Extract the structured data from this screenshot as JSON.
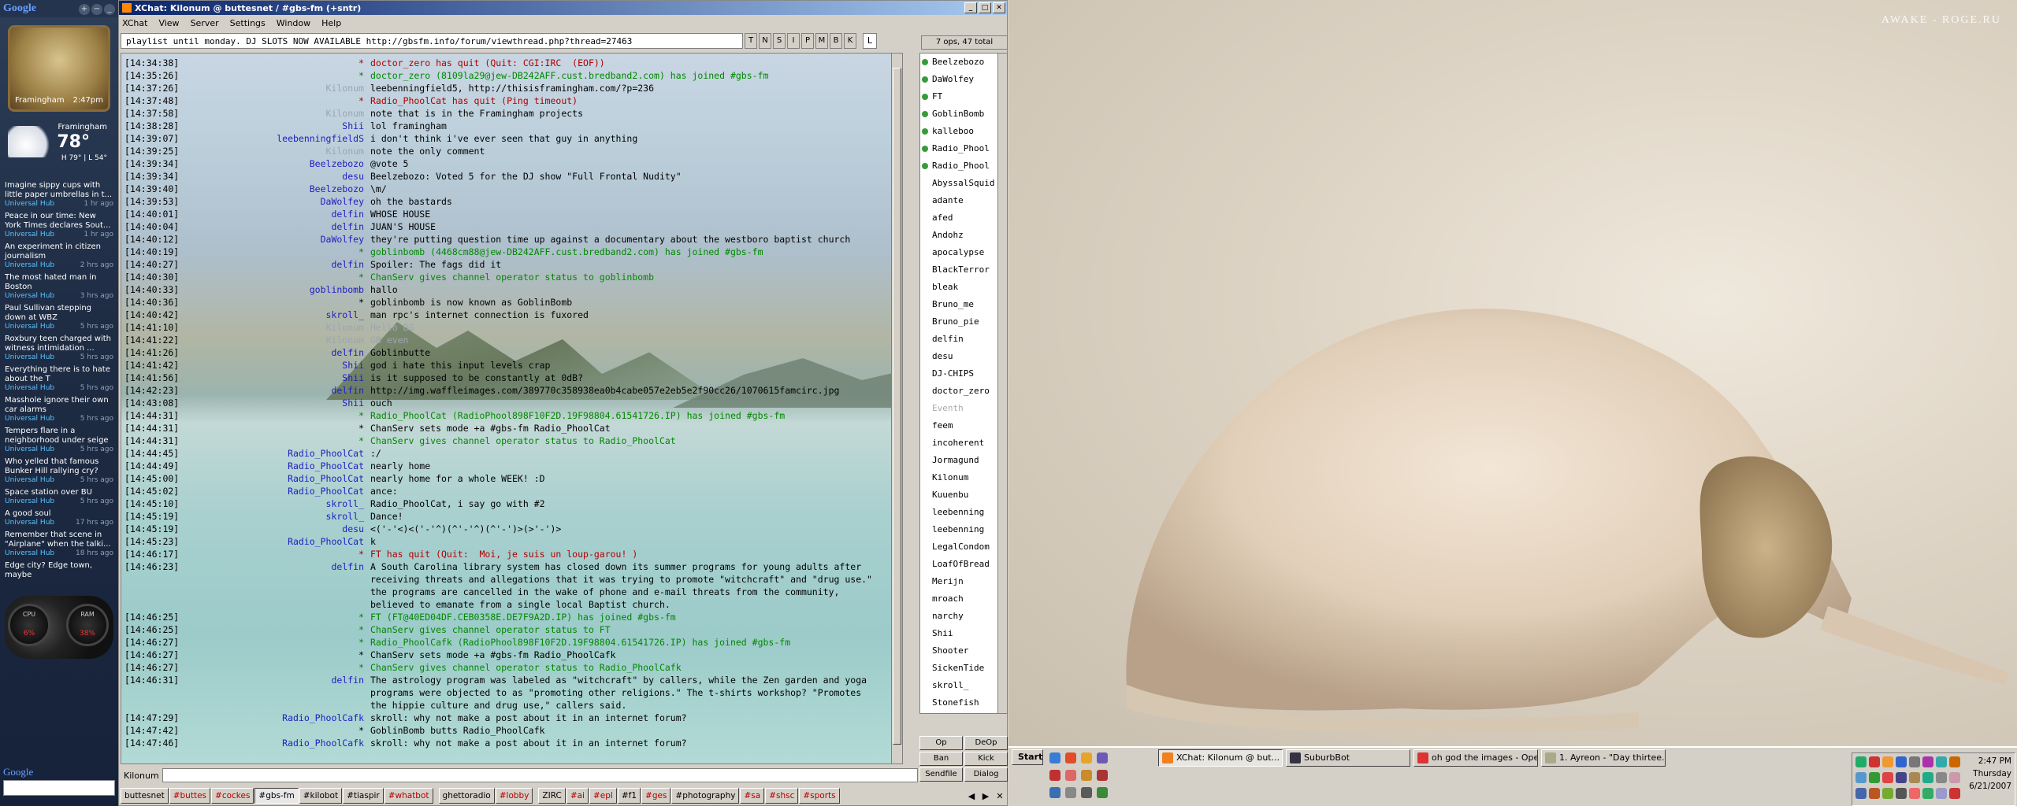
{
  "sidebar": {
    "logo": "Google",
    "clock": {
      "location": "Framingham",
      "time": "2:47pm"
    },
    "weather": {
      "city": "Framingham",
      "temp": "78°",
      "hilo": "H 79° | L 54°"
    },
    "news": [
      {
        "title": "Imagine sippy cups with little paper umbrellas in t...",
        "source": "Universal Hub",
        "age": "1 hr ago"
      },
      {
        "title": "Peace in our time: New York Times declares Sout...",
        "source": "Universal Hub",
        "age": "1 hr ago"
      },
      {
        "title": "An experiment in citizen journalism",
        "source": "Universal Hub",
        "age": "2 hrs ago"
      },
      {
        "title": "The most hated man in Boston",
        "source": "Universal Hub",
        "age": "3 hrs ago"
      },
      {
        "title": "Paul Sullivan stepping down at WBZ",
        "source": "Universal Hub",
        "age": "5 hrs ago"
      },
      {
        "title": "Roxbury teen charged with witness intimidation ...",
        "source": "Universal Hub",
        "age": "5 hrs ago"
      },
      {
        "title": "Everything there is to hate about the T",
        "source": "Universal Hub",
        "age": "5 hrs ago"
      },
      {
        "title": "Masshole ignore their own car alarms",
        "source": "Universal Hub",
        "age": "5 hrs ago"
      },
      {
        "title": "Tempers flare in a neighborhood under seige",
        "source": "Universal Hub",
        "age": "5 hrs ago"
      },
      {
        "title": "Who yelled that famous Bunker Hill rallying cry?",
        "source": "Universal Hub",
        "age": "5 hrs ago"
      },
      {
        "title": "Space station over BU",
        "source": "Universal Hub",
        "age": "5 hrs ago"
      },
      {
        "title": "A good soul",
        "source": "Universal Hub",
        "age": "17 hrs ago"
      },
      {
        "title": "Remember that scene in \"Airplane\" when the talki...",
        "source": "Universal Hub",
        "age": "18 hrs ago"
      },
      {
        "title": "Edge city? Edge town, maybe",
        "source": "",
        "age": ""
      }
    ],
    "cpu": {
      "cpu_label": "CPU",
      "cpu_value": "6%",
      "ram_label": "RAM",
      "ram_value": "38%"
    },
    "search_logo": "Google"
  },
  "window": {
    "title": "XChat: Kilonum @ buttesnet / #gbs-fm (+sntr)",
    "minimize": "_",
    "maximize": "□",
    "close": "✕"
  },
  "menu": [
    "XChat",
    "View",
    "Server",
    "Settings",
    "Window",
    "Help"
  ],
  "topic": "playlist until monday. DJ SLOTS NOW AVAILABLE http://gbsfm.info/forum/viewthread.php?thread=27463",
  "modes": [
    "T",
    "N",
    "S",
    "I",
    "P",
    "M",
    "B",
    "K"
  ],
  "limit_mode": "L",
  "userinfo": "7 ops, 47 total",
  "chat": [
    {
      "t": "[14:34:38]",
      "n": "*",
      "nc": "#b00000",
      "m": "doctor_zero has quit (Quit: CGI:IRC  (EOF))",
      "mc": "#b00000"
    },
    {
      "t": "[14:35:26]",
      "n": "*",
      "nc": "#008800",
      "m": "doctor_zero (8109la29@jew-DB242AFF.cust.bredband2.com) has joined #gbs-fm",
      "mc": "#008800"
    },
    {
      "t": "[14:37:26]",
      "n": "Kilonum",
      "nc": "#9aa6b0",
      "m": "leebenningfield5, http://thisisframingham.com/?p=236",
      "mc": "#000"
    },
    {
      "t": "[14:37:48]",
      "n": "*",
      "nc": "#b00000",
      "m": "Radio_PhoolCat has quit (Ping timeout)",
      "mc": "#b00000"
    },
    {
      "t": "[14:37:58]",
      "n": "Kilonum",
      "nc": "#9aa6b0",
      "m": "note that is in the Framingham projects",
      "mc": "#000"
    },
    {
      "t": "[14:38:28]",
      "n": "Shii",
      "nc": "#2020c0",
      "m": "lol framingham",
      "mc": "#000"
    },
    {
      "t": "[14:39:07]",
      "n": "leebenningfieldS",
      "nc": "#2020c0",
      "m": "i don't think i've ever seen that guy in anything",
      "mc": "#000"
    },
    {
      "t": "[14:39:25]",
      "n": "Kilonum",
      "nc": "#9aa6b0",
      "m": "note the only comment",
      "mc": "#000"
    },
    {
      "t": "[14:39:34]",
      "n": "Beelzebozo",
      "nc": "#2020c0",
      "m": "@vote 5",
      "mc": "#000"
    },
    {
      "t": "[14:39:34]",
      "n": "desu",
      "nc": "#2020c0",
      "m": "Beelzebozo: Voted 5 for the DJ show \"Full Frontal Nudity\"",
      "mc": "#000"
    },
    {
      "t": "[14:39:40]",
      "n": "Beelzebozo",
      "nc": "#2020c0",
      "m": "\\m/",
      "mc": "#000"
    },
    {
      "t": "[14:39:53]",
      "n": "DaWolfey",
      "nc": "#2020c0",
      "m": "oh the bastards",
      "mc": "#000"
    },
    {
      "t": "[14:40:01]",
      "n": "delfin",
      "nc": "#2020c0",
      "m": "WHOSE HOUSE",
      "mc": "#000"
    },
    {
      "t": "[14:40:04]",
      "n": "delfin",
      "nc": "#2020c0",
      "m": "JUAN'S HOUSE",
      "mc": "#000"
    },
    {
      "t": "[14:40:12]",
      "n": "DaWolfey",
      "nc": "#2020c0",
      "m": "they're putting question time up against a documentary about the westboro baptist church",
      "mc": "#000"
    },
    {
      "t": "[14:40:19]",
      "n": "*",
      "nc": "#008800",
      "m": "goblinbomb (4468cm88@jew-DB242AFF.cust.bredband2.com) has joined #gbs-fm",
      "mc": "#008800"
    },
    {
      "t": "[14:40:27]",
      "n": "delfin",
      "nc": "#2020c0",
      "m": "Spoiler: The fags did it",
      "mc": "#000"
    },
    {
      "t": "[14:40:30]",
      "n": "*",
      "nc": "#008800",
      "m": "ChanServ gives channel operator status to goblinbomb",
      "mc": "#008800"
    },
    {
      "t": "[14:40:33]",
      "n": "goblinbomb",
      "nc": "#2020c0",
      "m": "hallo",
      "mc": "#000"
    },
    {
      "t": "[14:40:36]",
      "n": "*",
      "nc": "#000",
      "m": "goblinbomb is now known as GoblinBomb",
      "mc": "#000"
    },
    {
      "t": "[14:40:42]",
      "n": "skroll_",
      "nc": "#2020c0",
      "m": "man rpc's internet connection is fuxored",
      "mc": "#000"
    },
    {
      "t": "[14:41:10]",
      "n": "Kilonum",
      "nc": "#9aa6b0",
      "m": "Hello BG",
      "mc": "#9aa6b0"
    },
    {
      "t": "[14:41:22]",
      "n": "Kilonum",
      "nc": "#9aa6b0",
      "m": "GB even",
      "mc": "#9aa6b0"
    },
    {
      "t": "[14:41:26]",
      "n": "delfin",
      "nc": "#2020c0",
      "m": "Goblinbutte",
      "mc": "#000"
    },
    {
      "t": "[14:41:42]",
      "n": "Shii",
      "nc": "#2020c0",
      "m": "god i hate this input levels crap",
      "mc": "#000"
    },
    {
      "t": "[14:41:56]",
      "n": "Shii",
      "nc": "#2020c0",
      "m": "is it supposed to be constantly at 0dB?",
      "mc": "#000"
    },
    {
      "t": "[14:42:23]",
      "n": "delfin",
      "nc": "#2020c0",
      "m": "http://img.waffleimages.com/389770c358938ea0b4cabe057e2eb5e2f90cc26/1070615famcirc.jpg",
      "mc": "#000"
    },
    {
      "t": "[14:43:08]",
      "n": "Shii",
      "nc": "#2020c0",
      "m": "ouch",
      "mc": "#000"
    },
    {
      "t": "[14:44:31]",
      "n": "*",
      "nc": "#008800",
      "m": "Radio_PhoolCat (RadioPhool898F10F2D.19F98804.61541726.IP) has joined #gbs-fm",
      "mc": "#008800"
    },
    {
      "t": "[14:44:31]",
      "n": "*",
      "nc": "#000",
      "m": "ChanServ sets mode +a #gbs-fm Radio_PhoolCat",
      "mc": "#000"
    },
    {
      "t": "[14:44:31]",
      "n": "*",
      "nc": "#008800",
      "m": "ChanServ gives channel operator status to Radio_PhoolCat",
      "mc": "#008800"
    },
    {
      "t": "[14:44:45]",
      "n": "Radio_PhoolCat",
      "nc": "#2020c0",
      "m": ":/",
      "mc": "#000"
    },
    {
      "t": "[14:44:49]",
      "n": "Radio_PhoolCat",
      "nc": "#2020c0",
      "m": "nearly home",
      "mc": "#000"
    },
    {
      "t": "[14:45:00]",
      "n": "Radio_PhoolCat",
      "nc": "#2020c0",
      "m": "nearly home for a whole WEEK! :D",
      "mc": "#000"
    },
    {
      "t": "[14:45:02]",
      "n": "Radio_PhoolCat",
      "nc": "#2020c0",
      "m": "ance:",
      "mc": "#000"
    },
    {
      "t": "[14:45:10]",
      "n": "skroll_",
      "nc": "#2020c0",
      "m": "Radio_PhoolCat, i say go with #2",
      "mc": "#000"
    },
    {
      "t": "[14:45:19]",
      "n": "skroll_",
      "nc": "#2020c0",
      "m": "Dance!",
      "mc": "#000"
    },
    {
      "t": "[14:45:19]",
      "n": "desu",
      "nc": "#2020c0",
      "m": "<('-'<)<('-'^)(^'-'^)(^'-')>(>'-')>",
      "mc": "#000"
    },
    {
      "t": "[14:45:23]",
      "n": "Radio_PhoolCat",
      "nc": "#2020c0",
      "m": "k",
      "mc": "#000"
    },
    {
      "t": "[14:46:17]",
      "n": "*",
      "nc": "#b00000",
      "m": "FT has quit (Quit:  Moi, je suis un loup-garou! )",
      "mc": "#b00000"
    },
    {
      "t": "[14:46:23]",
      "n": "delfin",
      "nc": "#2020c0",
      "m": "A South Carolina library system has closed down its summer programs for young adults after\nreceiving threats and allegations that it was trying to promote \"witchcraft\" and \"drug use.\"\nthe programs are cancelled in the wake of phone and e-mail threats from the community,\nbelieved to emanate from a single local Baptist church.",
      "mc": "#000"
    },
    {
      "t": "[14:46:25]",
      "n": "*",
      "nc": "#008800",
      "m": "FT (FT@40ED04DF.CEB0358E.DE7F9A2D.IP) has joined #gbs-fm",
      "mc": "#008800"
    },
    {
      "t": "[14:46:25]",
      "n": "*",
      "nc": "#008800",
      "m": "ChanServ gives channel operator status to FT",
      "mc": "#008800"
    },
    {
      "t": "[14:46:27]",
      "n": "*",
      "nc": "#008800",
      "m": "Radio_PhoolCafk (RadioPhool898F10F2D.19F98804.61541726.IP) has joined #gbs-fm",
      "mc": "#008800"
    },
    {
      "t": "[14:46:27]",
      "n": "*",
      "nc": "#000",
      "m": "ChanServ sets mode +a #gbs-fm Radio_PhoolCafk",
      "mc": "#000"
    },
    {
      "t": "[14:46:27]",
      "n": "*",
      "nc": "#008800",
      "m": "ChanServ gives channel operator status to Radio_PhoolCafk",
      "mc": "#008800"
    },
    {
      "t": "[14:46:31]",
      "n": "delfin",
      "nc": "#2020c0",
      "m": "The astrology program was labeled as \"witchcraft\" by callers, while the Zen garden and yoga\nprograms were objected to as \"promoting other religions.\" The t-shirts workshop? \"Promotes\nthe hippie culture and drug use,\" callers said.",
      "mc": "#000"
    },
    {
      "t": "[14:47:29]",
      "n": "Radio_PhoolCafk",
      "nc": "#2020c0",
      "m": "skroll: why not make a post about it in an internet forum?",
      "mc": "#000"
    },
    {
      "t": "[14:47:42]",
      "n": "*",
      "nc": "#000",
      "m": "GoblinBomb butts Radio_PhoolCafk",
      "mc": "#000"
    },
    {
      "t": "[14:47:46]",
      "n": "Radio_PhoolCafk",
      "nc": "#2020c0",
      "m": "skroll: why not make a post about it in an internet forum?",
      "mc": "#000"
    }
  ],
  "nicklist": [
    {
      "nick": "Beelzebozo",
      "op": true
    },
    {
      "nick": "DaWolfey",
      "op": true
    },
    {
      "nick": "FT",
      "op": true
    },
    {
      "nick": "GoblinBomb",
      "op": true
    },
    {
      "nick": "kalleboo",
      "op": true
    },
    {
      "nick": "Radio_Phool",
      "op": true
    },
    {
      "nick": "Radio_Phool",
      "op": true
    },
    {
      "nick": "AbyssalSquid",
      "op": false
    },
    {
      "nick": "adante",
      "op": false
    },
    {
      "nick": "afed",
      "op": false
    },
    {
      "nick": "Andohz",
      "op": false
    },
    {
      "nick": "apocalypse",
      "op": false
    },
    {
      "nick": "BlackTerror",
      "op": false
    },
    {
      "nick": "bleak",
      "op": false
    },
    {
      "nick": "Bruno_me",
      "op": false
    },
    {
      "nick": "Bruno_pie",
      "op": false
    },
    {
      "nick": "delfin",
      "op": false
    },
    {
      "nick": "desu",
      "op": false
    },
    {
      "nick": "DJ-CHIPS",
      "op": false
    },
    {
      "nick": "doctor_zero",
      "op": false
    },
    {
      "nick": "Eventh",
      "op": false,
      "grey": true
    },
    {
      "nick": "feem",
      "op": false
    },
    {
      "nick": "incoherent",
      "op": false
    },
    {
      "nick": "Jormagund",
      "op": false
    },
    {
      "nick": "Kilonum",
      "op": false
    },
    {
      "nick": "Kuuenbu",
      "op": false
    },
    {
      "nick": "leebenning",
      "op": false
    },
    {
      "nick": "leebenning",
      "op": false
    },
    {
      "nick": "LegalCondom",
      "op": false
    },
    {
      "nick": "LoafOfBread",
      "op": false
    },
    {
      "nick": "Merijn",
      "op": false
    },
    {
      "nick": "mroach",
      "op": false
    },
    {
      "nick": "narchy",
      "op": false
    },
    {
      "nick": "Shii",
      "op": false
    },
    {
      "nick": "Shooter",
      "op": false
    },
    {
      "nick": "SickenTide",
      "op": false
    },
    {
      "nick": "skroll_",
      "op": false
    },
    {
      "nick": "Stonefish",
      "op": false
    }
  ],
  "nick_buttons": [
    "Op",
    "DeOp",
    "Ban",
    "Kick",
    "Sendfile",
    "Dialog"
  ],
  "input_nick": "Kilonum",
  "tabs": [
    {
      "label": "buttesnet",
      "red": false
    },
    {
      "label": "#buttes",
      "red": true
    },
    {
      "label": "#cockes",
      "red": true
    },
    {
      "label": "#gbs-fm",
      "red": false,
      "sel": true
    },
    {
      "label": "#kilobot",
      "red": false
    },
    {
      "label": "#tiaspir",
      "red": false
    },
    {
      "label": "#whatbot",
      "red": true
    },
    {
      "sep": true
    },
    {
      "label": "ghettoradio",
      "red": false
    },
    {
      "label": "#lobby",
      "red": true
    },
    {
      "sep": true
    },
    {
      "label": "ZIRC",
      "red": false
    },
    {
      "label": "#ai",
      "red": true
    },
    {
      "label": "#epl",
      "red": true
    },
    {
      "label": "#f1",
      "red": false
    },
    {
      "label": "#ges",
      "red": true
    },
    {
      "label": "#photography",
      "red": false
    },
    {
      "label": "#sa",
      "red": true
    },
    {
      "label": "#shsc",
      "red": true
    },
    {
      "label": "#sports",
      "red": true
    }
  ],
  "tab_nav": [
    "◀",
    "▶",
    "✕"
  ],
  "desktop": {
    "watermark": "AWAKE - ROGE.RU"
  },
  "taskbar": {
    "start": "Start",
    "buttons": [
      "XChat: Kilonum @ but...",
      "SuburbBot",
      "oh god the images - Opera",
      "1. Ayreon - \"Day thirtee..."
    ],
    "time": "2:47 PM",
    "day": "Thursday",
    "date": "6/21/2007"
  },
  "colors": {
    "opdot": "#3a9a3a",
    "join": "#008800",
    "quit": "#b00000",
    "nick": "#2020c0",
    "titlebar": "#0a246a"
  }
}
